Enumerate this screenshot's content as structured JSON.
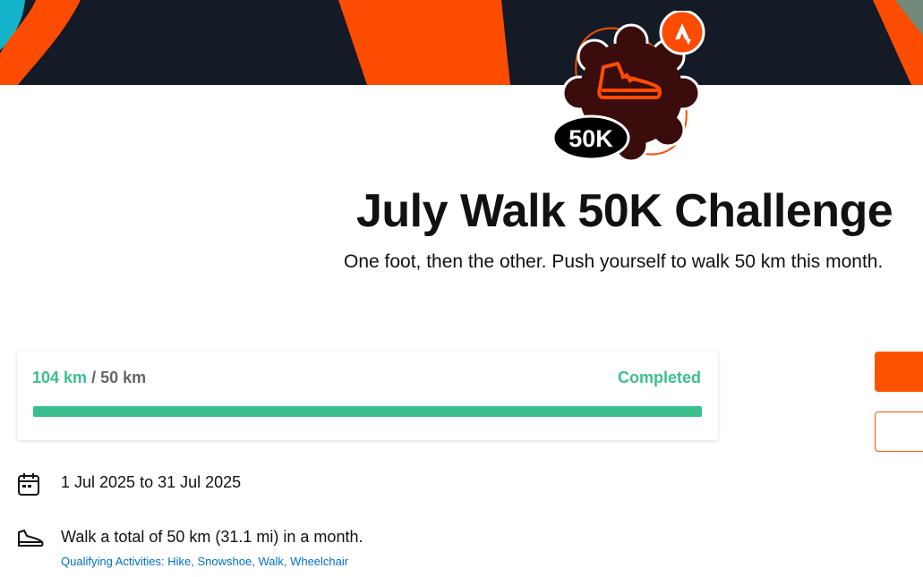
{
  "banner": {
    "colors": {
      "background": "#141a26",
      "accent_orange": "#fc4c02",
      "accent_cyan": "#14b4cc"
    }
  },
  "badge": {
    "icon": "walking-shoe-icon",
    "label": "50K",
    "brand_icon": "strava-logo-icon"
  },
  "challenge": {
    "title": "July Walk 50K Challenge",
    "subtitle": "One foot, then the other. Push yourself to walk 50 km this month."
  },
  "progress": {
    "completed_value": "104 km",
    "separator": "/",
    "goal_value": "50 km",
    "status": "Completed",
    "fraction": 1.0,
    "colors": {
      "fill": "#3cbf8e",
      "track": "#e6e6e6"
    }
  },
  "details": {
    "date_icon": "calendar-icon",
    "date_range": "1 Jul 2025 to 31 Jul 2025",
    "goal_icon": "shoe-icon",
    "goal_text": "Walk a total of 50 km (31.1 mi) in a month.",
    "qualifying_label": "Qualifying Activities:",
    "qualifying_activities": [
      "Hike",
      "Snowshoe",
      "Walk",
      "Wheelchair"
    ]
  },
  "actions": {
    "colors": {
      "primary": "#fc5200"
    }
  }
}
